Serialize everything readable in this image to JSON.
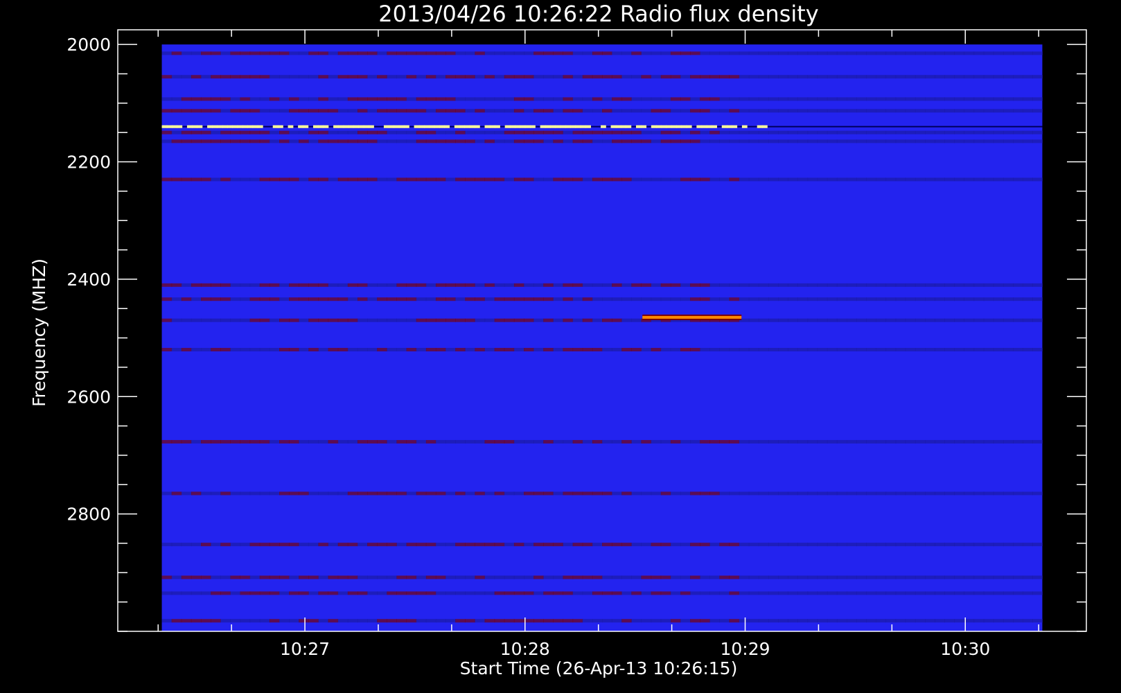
{
  "chart_data": {
    "type": "heatmap",
    "title": "2013/04/26 10:26:22 Radio flux density",
    "xlabel": "Start Time (26-Apr-13 10:26:15)",
    "ylabel": "Frequency (MHZ)",
    "x_tick_labels": [
      "10:27",
      "10:28",
      "10:29",
      "10:30"
    ],
    "y_tick_labels": [
      "2000",
      "2200",
      "2400",
      "2600",
      "2800"
    ],
    "x_ticks_seconds_from_start": [
      45,
      105,
      165,
      225
    ],
    "x_range_seconds_from_start": [
      -6,
      258
    ],
    "data_extent_seconds_from_start": [
      6,
      246
    ],
    "y_range_mhz": [
      1975,
      3000
    ],
    "data_extent_mhz": [
      2000,
      3000
    ],
    "y_invert": true,
    "colormap": [
      "#0000ff",
      "#7a0000",
      "#ff5500",
      "#ffffa0"
    ],
    "background_color": "#2323ef",
    "emission_lanes_mhz": [
      2015,
      2055,
      2093,
      2113,
      2150,
      2165,
      2230,
      2410,
      2434,
      2470,
      2520,
      2677,
      2765,
      2852,
      2908,
      2935,
      2982
    ],
    "bright_burst": {
      "freq_mhz": 2140,
      "time_seconds_from_start": [
        6,
        171
      ],
      "color": "#ffff99"
    },
    "feature_burst": {
      "freq_mhz": 2465,
      "time_seconds_from_start": [
        137,
        164
      ],
      "color": "#ff8800"
    }
  }
}
